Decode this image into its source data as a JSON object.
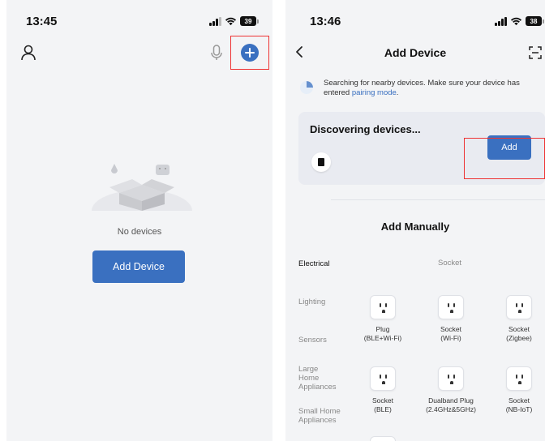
{
  "left_screen": {
    "status": {
      "time": "13:45",
      "battery": "39"
    },
    "no_devices_text": "No devices",
    "add_device_button": "Add Device"
  },
  "right_screen": {
    "status": {
      "time": "13:46",
      "battery": "38"
    },
    "nav_title": "Add Device",
    "search_message": "Searching for nearby devices. Make sure your device has entered ",
    "search_link": "pairing mode",
    "search_suffix": ".",
    "discover_title": "Discovering devices...",
    "add_button": "Add",
    "add_manually_title": "Add Manually",
    "categories": [
      "Electrical",
      "Lighting",
      "Sensors",
      "Large Home Appliances",
      "Small Home Appliances"
    ],
    "socket_heading": "Socket",
    "devices": [
      {
        "name": "Plug",
        "sub": "(BLE+Wi-Fi)"
      },
      {
        "name": "Socket",
        "sub": "(Wi-Fi)"
      },
      {
        "name": "Socket",
        "sub": "(Zigbee)"
      },
      {
        "name": "Socket",
        "sub": "(BLE)"
      },
      {
        "name": "Dualband Plug",
        "sub": "(2.4GHz&5GHz)"
      },
      {
        "name": "Socket",
        "sub": "(NB-IoT)"
      }
    ]
  },
  "icons": [
    "signal-icon",
    "wifi-icon",
    "battery-icon",
    "user-icon",
    "microphone-icon",
    "plus-icon",
    "back-icon",
    "scan-icon",
    "device-icon",
    "socket-icon"
  ],
  "colors": {
    "accent": "#3a70c0",
    "background": "#f3f4f6",
    "card": "#e9ebf1",
    "highlight": "#ee3333"
  }
}
